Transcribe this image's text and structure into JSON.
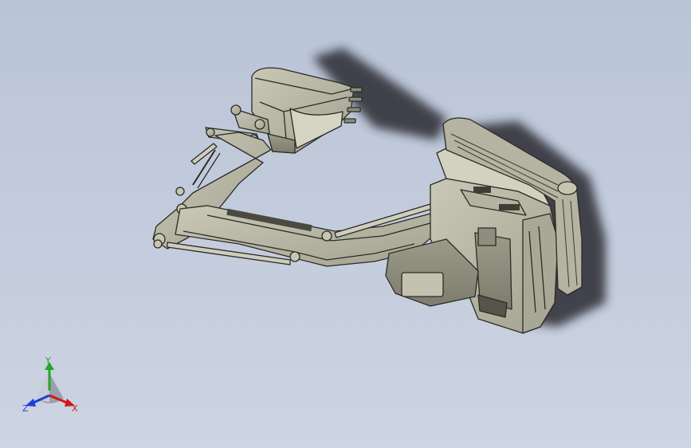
{
  "triad": {
    "x_label": "X",
    "y_label": "Y",
    "z_label": "Z"
  },
  "colors": {
    "background_top": "#b9c4d6",
    "background_bottom": "#cdd4e2",
    "model_body": "#b9b8a6",
    "model_shadow": "#8f8f7e",
    "edges": "#2b2b26",
    "axis_x": "#d01818",
    "axis_y": "#22a52a",
    "axis_z": "#1f3fd6"
  }
}
